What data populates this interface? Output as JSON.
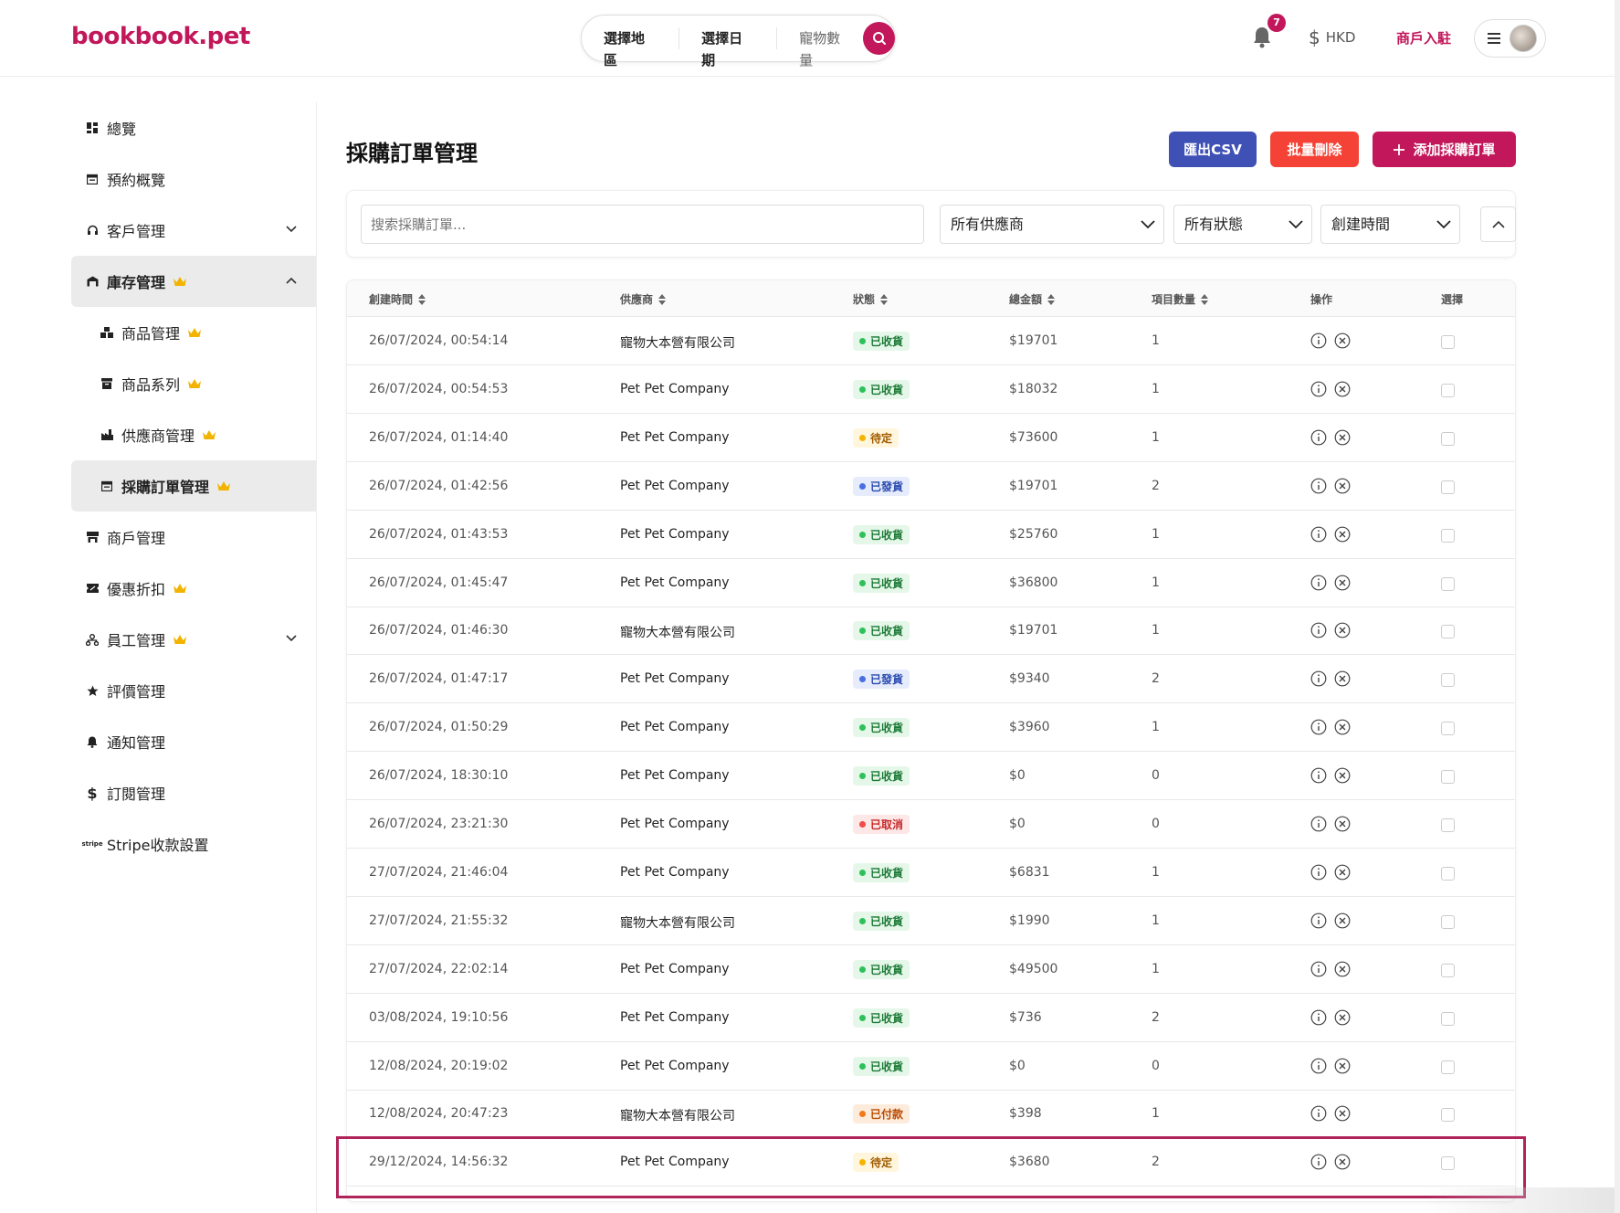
{
  "brand": {
    "logo": "bookbook.pet",
    "accent": "#c2185b"
  },
  "search": {
    "region": "選擇地區",
    "date": "選擇日期",
    "pets": "寵物數量"
  },
  "header": {
    "notifications_count": "7",
    "currency": "HKD",
    "merchant_link": "商戶入駐"
  },
  "sidebar": {
    "items": [
      {
        "label": "總覽",
        "icon": "dashboard-icon"
      },
      {
        "label": "預約概覽",
        "icon": "calendar-icon"
      },
      {
        "label": "客戶管理",
        "icon": "headset-icon"
      },
      {
        "label": "庫存管理",
        "icon": "warehouse-icon"
      },
      {
        "label": "商品管理",
        "icon": "boxes-icon"
      },
      {
        "label": "商品系列",
        "icon": "archive-icon"
      },
      {
        "label": "供應商管理",
        "icon": "factory-icon"
      },
      {
        "label": "採購訂單管理",
        "icon": "order-icon"
      },
      {
        "label": "商戶管理",
        "icon": "store-icon"
      },
      {
        "label": "優惠折扣",
        "icon": "ticket-icon"
      },
      {
        "label": "員工管理",
        "icon": "org-icon"
      },
      {
        "label": "評價管理",
        "icon": "star-icon"
      },
      {
        "label": "通知管理",
        "icon": "bell-icon"
      },
      {
        "label": "訂閱管理",
        "icon": "dollar-icon"
      },
      {
        "label": "Stripe收款設置",
        "icon": "stripe-icon"
      }
    ]
  },
  "main": {
    "title": "採購訂單管理",
    "export_label": "匯出CSV",
    "bulk_delete_label": "批量刪除",
    "add_label": "添加採購訂單"
  },
  "filters": {
    "search_placeholder": "搜索採購訂單...",
    "supplier": "所有供應商",
    "status": "所有狀態",
    "sort": "創建時間"
  },
  "table": {
    "headers": {
      "created": "創建時間",
      "supplier": "供應商",
      "status": "狀態",
      "total": "總金額",
      "items": "項目數量",
      "actions": "操作",
      "select": "選擇"
    },
    "rows": [
      {
        "created": "26/07/2024, 00:54:14",
        "supplier": "寵物大本營有限公司",
        "status": "已收貨",
        "status_key": "received",
        "total": "$19701",
        "items": "1"
      },
      {
        "created": "26/07/2024, 00:54:53",
        "supplier": "Pet Pet Company",
        "status": "已收貨",
        "status_key": "received",
        "total": "$18032",
        "items": "1"
      },
      {
        "created": "26/07/2024, 01:14:40",
        "supplier": "Pet Pet Company",
        "status": "待定",
        "status_key": "pending",
        "total": "$73600",
        "items": "1"
      },
      {
        "created": "26/07/2024, 01:42:56",
        "supplier": "Pet Pet Company",
        "status": "已發貨",
        "status_key": "shipped",
        "total": "$19701",
        "items": "2"
      },
      {
        "created": "26/07/2024, 01:43:53",
        "supplier": "Pet Pet Company",
        "status": "已收貨",
        "status_key": "received",
        "total": "$25760",
        "items": "1"
      },
      {
        "created": "26/07/2024, 01:45:47",
        "supplier": "Pet Pet Company",
        "status": "已收貨",
        "status_key": "received",
        "total": "$36800",
        "items": "1"
      },
      {
        "created": "26/07/2024, 01:46:30",
        "supplier": "寵物大本營有限公司",
        "status": "已收貨",
        "status_key": "received",
        "total": "$19701",
        "items": "1"
      },
      {
        "created": "26/07/2024, 01:47:17",
        "supplier": "Pet Pet Company",
        "status": "已發貨",
        "status_key": "shipped",
        "total": "$9340",
        "items": "2"
      },
      {
        "created": "26/07/2024, 01:50:29",
        "supplier": "Pet Pet Company",
        "status": "已收貨",
        "status_key": "received",
        "total": "$3960",
        "items": "1"
      },
      {
        "created": "26/07/2024, 18:30:10",
        "supplier": "Pet Pet Company",
        "status": "已收貨",
        "status_key": "received",
        "total": "$0",
        "items": "0"
      },
      {
        "created": "26/07/2024, 23:21:30",
        "supplier": "Pet Pet Company",
        "status": "已取消",
        "status_key": "cancelled",
        "total": "$0",
        "items": "0"
      },
      {
        "created": "27/07/2024, 21:46:04",
        "supplier": "Pet Pet Company",
        "status": "已收貨",
        "status_key": "received",
        "total": "$6831",
        "items": "1"
      },
      {
        "created": "27/07/2024, 21:55:32",
        "supplier": "寵物大本營有限公司",
        "status": "已收貨",
        "status_key": "received",
        "total": "$1990",
        "items": "1"
      },
      {
        "created": "27/07/2024, 22:02:14",
        "supplier": "Pet Pet Company",
        "status": "已收貨",
        "status_key": "received",
        "total": "$49500",
        "items": "1"
      },
      {
        "created": "03/08/2024, 19:10:56",
        "supplier": "Pet Pet Company",
        "status": "已收貨",
        "status_key": "received",
        "total": "$736",
        "items": "2"
      },
      {
        "created": "12/08/2024, 20:19:02",
        "supplier": "Pet Pet Company",
        "status": "已收貨",
        "status_key": "received",
        "total": "$0",
        "items": "0"
      },
      {
        "created": "12/08/2024, 20:47:23",
        "supplier": "寵物大本營有限公司",
        "status": "已付款",
        "status_key": "paid",
        "total": "$398",
        "items": "1"
      },
      {
        "created": "29/12/2024, 14:56:32",
        "supplier": "Pet Pet Company",
        "status": "待定",
        "status_key": "pending",
        "total": "$3680",
        "items": "2"
      }
    ]
  }
}
